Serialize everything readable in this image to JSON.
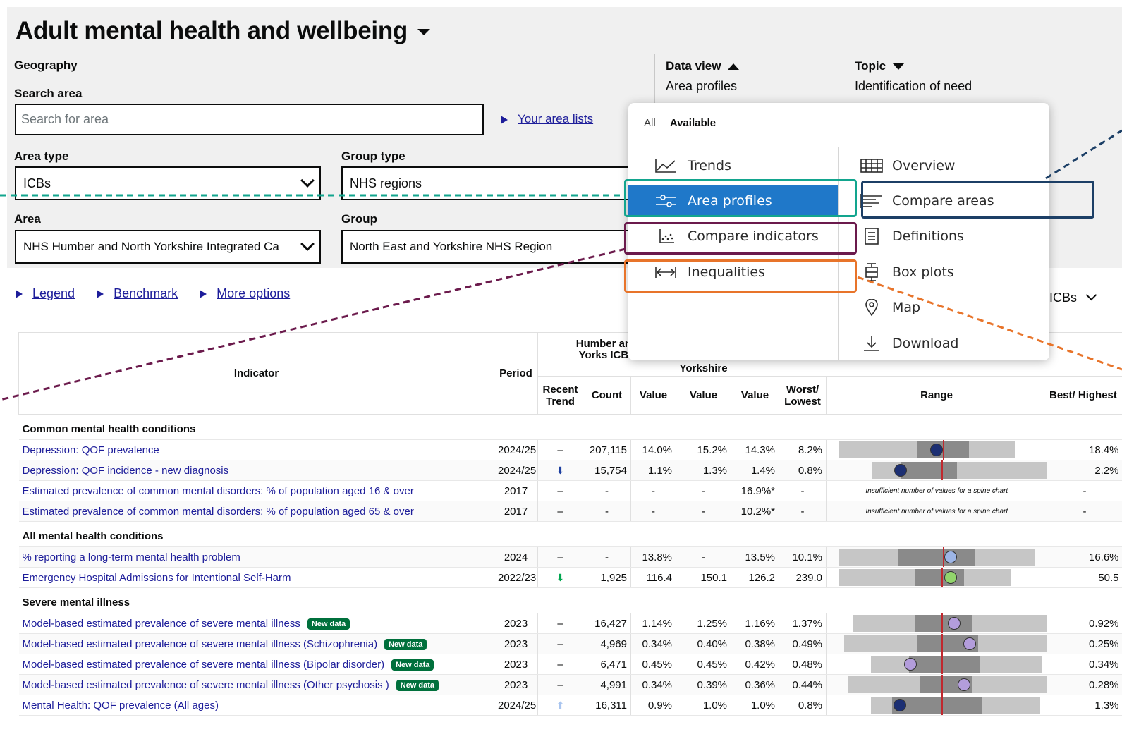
{
  "header": {
    "title": "Adult mental health and wellbeing"
  },
  "geography": {
    "label": "Geography",
    "search_label": "Search area",
    "search_placeholder": "Search for area",
    "area_lists_link": "Your area lists",
    "area_type_label": "Area type",
    "area_type_value": "ICBs",
    "group_type_label": "Group type",
    "group_type_value": "NHS regions",
    "area_label": "Area",
    "area_value": "NHS Humber and North Yorkshire Integrated Ca",
    "group_label": "Group",
    "group_value": "North East and Yorkshire NHS Region"
  },
  "data_view": {
    "label": "Data view",
    "value": "Area profiles"
  },
  "topic": {
    "label": "Topic",
    "value": "Identification of need"
  },
  "links": {
    "legend": "Legend",
    "benchmark": "Benchmark",
    "more_options": "More options"
  },
  "right_select": {
    "value": "ICBs"
  },
  "menu": {
    "tab_all": "All",
    "tab_available": "Available",
    "left": [
      {
        "label": "Trends",
        "icon": "line-chart-icon"
      },
      {
        "label": "Area profiles",
        "icon": "sliders-icon",
        "active": true
      },
      {
        "label": "Compare indicators",
        "icon": "scatter-icon"
      },
      {
        "label": "Inequalities",
        "icon": "arrows-horizontal-icon"
      }
    ],
    "right": [
      {
        "label": "Overview",
        "icon": "grid-table-icon"
      },
      {
        "label": "Compare areas",
        "icon": "bars-left-icon"
      },
      {
        "label": "Definitions",
        "icon": "document-icon"
      },
      {
        "label": "Box plots",
        "icon": "box-plot-icon"
      },
      {
        "label": "Map",
        "icon": "map-pin-icon"
      },
      {
        "label": "Download",
        "icon": "download-icon"
      }
    ]
  },
  "table": {
    "headers": {
      "indicator": "Indicator",
      "period": "Period",
      "area_group": "Humber and N Yorks ICB - 0",
      "area_group_line1": "Humber and",
      "area_group_line2": "Yorks ICB - ",
      "region_group": "Yorkshire",
      "recent_trend": "Recent Trend",
      "count": "Count",
      "value1": "Value",
      "value2": "Value",
      "value3": "Value",
      "worst": "Worst/ Lowest",
      "range": "Range",
      "best": "Best/ Highest"
    },
    "insufficient_text": "Insufficient number of values for a spine chart",
    "sections": [
      {
        "title": "Common mental health conditions",
        "rows": [
          {
            "indicator": "Depression: QOF prevalence",
            "period": "2024/25",
            "trend": "–",
            "count": "207,115",
            "v1": "14.0%",
            "v2": "15.2%",
            "v3": "14.3%",
            "worst": "8.2%",
            "best": "18.4%"
          },
          {
            "indicator": "Depression: QOF incidence - new diagnosis",
            "period": "2024/25",
            "trend": "⬇",
            "count": "15,754",
            "v1": "1.1%",
            "v2": "1.3%",
            "v3": "1.4%",
            "worst": "0.8%",
            "best": "2.2%"
          },
          {
            "indicator": "Estimated prevalence of common mental disorders: % of population aged 16 & over",
            "period": "2017",
            "trend": "–",
            "count": "-",
            "v1": "-",
            "v2": "-",
            "v3": "16.9%*",
            "worst": "-",
            "best": "-"
          },
          {
            "indicator": "Estimated prevalence of common mental disorders: % of population aged 65 & over",
            "period": "2017",
            "trend": "–",
            "count": "-",
            "v1": "-",
            "v2": "-",
            "v3": "10.2%*",
            "worst": "-",
            "best": "-"
          }
        ]
      },
      {
        "title": "All mental health conditions",
        "rows": [
          {
            "indicator": "% reporting a long-term mental health problem",
            "period": "2024",
            "trend": "–",
            "count": "-",
            "v1": "13.8%",
            "v2": "-",
            "v3": "13.5%",
            "worst": "10.1%",
            "best": "16.6%"
          },
          {
            "indicator": "Emergency Hospital Admissions for Intentional Self-Harm",
            "period": "2022/23",
            "trend": "⬇",
            "count": "1,925",
            "v1": "116.4",
            "v2": "150.1",
            "v3": "126.2",
            "worst": "239.0",
            "best": "50.5"
          }
        ]
      },
      {
        "title": "Severe mental illness",
        "rows": [
          {
            "indicator": "Model-based estimated prevalence of severe mental illness",
            "badge": "New data",
            "period": "2023",
            "trend": "–",
            "count": "16,427",
            "v1": "1.14%",
            "v2": "1.25%",
            "v3": "1.16%",
            "worst": "1.37%",
            "best": "0.92%"
          },
          {
            "indicator": "Model-based estimated prevalence of severe mental illness (Schizophrenia)",
            "badge": "New data",
            "period": "2023",
            "trend": "–",
            "count": "4,969",
            "v1": "0.34%",
            "v2": "0.40%",
            "v3": "0.38%",
            "worst": "0.49%",
            "best": "0.25%"
          },
          {
            "indicator": "Model-based estimated prevalence of severe mental illness (Bipolar disorder)",
            "badge": "New data",
            "period": "2023",
            "trend": "–",
            "count": "6,471",
            "v1": "0.45%",
            "v2": "0.45%",
            "v3": "0.42%",
            "worst": "0.48%",
            "best": "0.34%"
          },
          {
            "indicator": "Model-based estimated prevalence of severe mental illness (Other psychosis )",
            "badge": "New data",
            "period": "2023",
            "trend": "–",
            "count": "4,991",
            "v1": "0.34%",
            "v2": "0.39%",
            "v3": "0.36%",
            "worst": "0.44%",
            "best": "0.28%"
          },
          {
            "indicator": "Mental Health: QOF prevalence (All ages)",
            "period": "2024/25",
            "trend": "⬆",
            "count": "16,311",
            "v1": "0.9%",
            "v2": "1.0%",
            "v3": "1.0%",
            "worst": "0.8%",
            "best": "1.3%"
          }
        ]
      }
    ]
  },
  "colors": {
    "link": "#1d1d9a",
    "active_menu": "#1f78c9",
    "highlight_teal": "#12a58e",
    "highlight_navy": "#1c3f66",
    "highlight_maroon": "#6b1a4c",
    "highlight_orange": "#e8742a",
    "dot_navy": "#1c2f73",
    "dot_lightblue": "#9db5e6",
    "dot_green": "#92d46c",
    "dot_purple": "#b39ddb",
    "benchmark_line": "#c0282e",
    "badge_green": "#00703c"
  }
}
